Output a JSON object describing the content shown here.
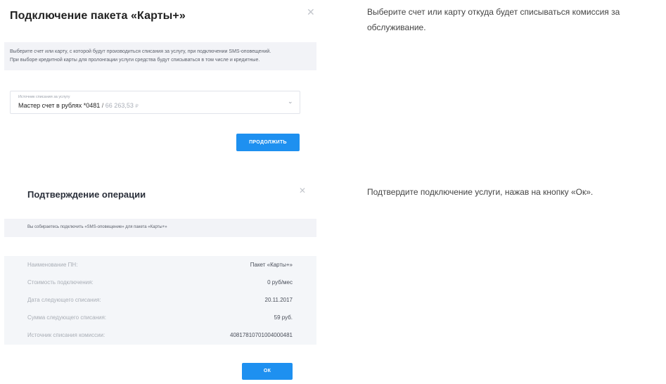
{
  "dialog1": {
    "title": "Подключение пакета «Карты+»",
    "close_icon": "close-icon",
    "info_line1": "Выберите счет или карту, с которой будут производиться списания за услугу, при подключении SMS-оповещений.",
    "info_line2": "При выборе кредитной карты для пролонгации услуги средства будут списываться в том числе и кредитные.",
    "select": {
      "caption": "Источник списания за услугу",
      "account": "Мастер счет в рублях *0481",
      "separator": "/",
      "balance": "66 263,53",
      "currency": "₽",
      "chevron_icon": "chevron-down-icon"
    },
    "button_label": "ПРОДОЛЖИТЬ"
  },
  "dialog2": {
    "title": "Подтверждение операции",
    "close_icon": "close-icon",
    "info_text": "Вы собираетесь подключить «SMS-оповещение» для пакета «Карты+»",
    "rows": [
      {
        "label": "Наименование ПН:",
        "value": "Пакет «Карты+»"
      },
      {
        "label": "Стоимость подключения:",
        "value": "0 руб/мес"
      },
      {
        "label": "Дата следующего списания:",
        "value": "20.11.2017"
      },
      {
        "label": "Сумма следующего списания:",
        "value": "59 руб."
      },
      {
        "label": "Источник списания комиссии:",
        "value": "40817810701004000481"
      }
    ],
    "button_label": "ОК"
  },
  "instructions": {
    "step1": "Выберите счет или карту откуда будет списываться комиссия за обслуживание.",
    "step2": "Подтвердите подключение услуги, нажав на кнопку «Ок»."
  },
  "colors": {
    "accent": "#1e90f0",
    "info_background": "#f2f3f7"
  }
}
